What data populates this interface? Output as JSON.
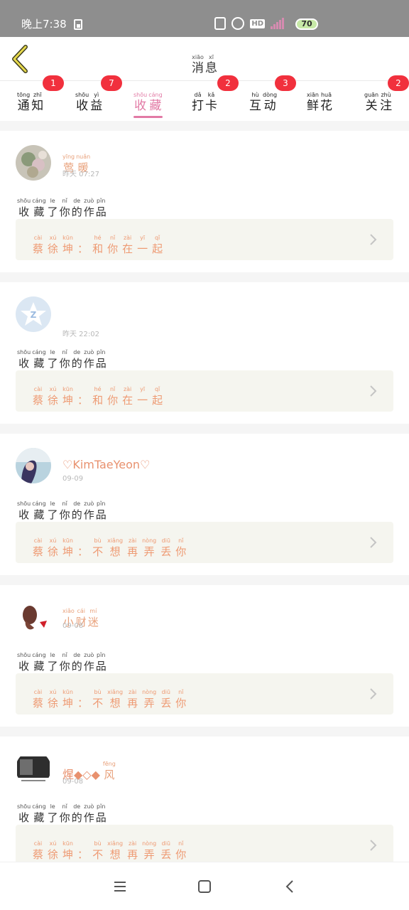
{
  "status_bar": {
    "time": "晚上7:38",
    "hd": "HD",
    "battery": "70"
  },
  "header": {
    "title": [
      {
        "py": "xiāo",
        "hz": "消"
      },
      {
        "py": "xī",
        "hz": "息"
      }
    ]
  },
  "tabs": [
    {
      "label": [
        {
          "py": "tōng",
          "hz": "通"
        },
        {
          "py": "zhī",
          "hz": "知"
        }
      ],
      "badge": "1",
      "active": false
    },
    {
      "label": [
        {
          "py": "shōu",
          "hz": "收"
        },
        {
          "py": "yì",
          "hz": "益"
        }
      ],
      "badge": "7",
      "active": false
    },
    {
      "label": [
        {
          "py": "shōu",
          "hz": "收"
        },
        {
          "py": "cáng",
          "hz": "藏"
        }
      ],
      "badge": "",
      "active": true
    },
    {
      "label": [
        {
          "py": "dǎ",
          "hz": "打"
        },
        {
          "py": "kǎ",
          "hz": "卡"
        }
      ],
      "badge": "2",
      "active": false
    },
    {
      "label": [
        {
          "py": "hù",
          "hz": "互"
        },
        {
          "py": "dòng",
          "hz": "动"
        }
      ],
      "badge": "3",
      "active": false
    },
    {
      "label": [
        {
          "py": "xiān",
          "hz": "鲜"
        },
        {
          "py": "huā",
          "hz": "花"
        }
      ],
      "badge": "",
      "active": false
    },
    {
      "label": [
        {
          "py": "guān",
          "hz": "关"
        },
        {
          "py": "zhù",
          "hz": "注"
        }
      ],
      "badge": "2",
      "active": false
    }
  ],
  "action": [
    {
      "py": "shōu",
      "hz": "收"
    },
    {
      "py": "cáng",
      "hz": "藏"
    },
    {
      "py": "le",
      "hz": "了"
    },
    {
      "py": "nǐ",
      "hz": "你"
    },
    {
      "py": "de",
      "hz": "的"
    },
    {
      "py": "zuò",
      "hz": "作"
    },
    {
      "py": "pǐn",
      "hz": "品"
    }
  ],
  "cards": [
    {
      "username": [
        {
          "py": "yīng",
          "hz": "莺"
        },
        {
          "py": "nuǎn",
          "hz": "暖"
        }
      ],
      "username_plain": "",
      "time": "昨天 07:27",
      "work": [
        {
          "py": "cài",
          "hz": "蔡"
        },
        {
          "py": "xú",
          "hz": "徐"
        },
        {
          "py": "kūn",
          "hz": "坤"
        },
        {
          "py": "",
          "hz": "："
        },
        {
          "py": "hé",
          "hz": "和"
        },
        {
          "py": "nǐ",
          "hz": "你"
        },
        {
          "py": "zài",
          "hz": "在"
        },
        {
          "py": "yī",
          "hz": "一"
        },
        {
          "py": "qǐ",
          "hz": "起"
        }
      ],
      "avatar": "photo-flowers"
    },
    {
      "username": [],
      "username_plain": "",
      "time": "昨天 22:02",
      "work": [
        {
          "py": "cài",
          "hz": "蔡"
        },
        {
          "py": "xú",
          "hz": "徐"
        },
        {
          "py": "kūn",
          "hz": "坤"
        },
        {
          "py": "",
          "hz": "："
        },
        {
          "py": "hé",
          "hz": "和"
        },
        {
          "py": "nǐ",
          "hz": "你"
        },
        {
          "py": "zài",
          "hz": "在"
        },
        {
          "py": "yī",
          "hz": "一"
        },
        {
          "py": "qǐ",
          "hz": "起"
        }
      ],
      "avatar": "qq-star"
    },
    {
      "username": [],
      "username_plain": "♡KimTaeYeon♡",
      "time": "09-09",
      "work": [
        {
          "py": "cài",
          "hz": "蔡"
        },
        {
          "py": "xú",
          "hz": "徐"
        },
        {
          "py": "kūn",
          "hz": "坤"
        },
        {
          "py": "",
          "hz": "："
        },
        {
          "py": "bù",
          "hz": "不"
        },
        {
          "py": "xiǎng",
          "hz": "想"
        },
        {
          "py": "zài",
          "hz": "再"
        },
        {
          "py": "nòng",
          "hz": "弄"
        },
        {
          "py": "diū",
          "hz": "丢"
        },
        {
          "py": "nǐ",
          "hz": "你"
        }
      ],
      "avatar": "photo-girl"
    },
    {
      "username": [
        {
          "py": "xiǎo",
          "hz": "小"
        },
        {
          "py": "cái",
          "hz": "财"
        },
        {
          "py": "mí",
          "hz": "迷"
        }
      ],
      "username_plain": "",
      "time": "09-08",
      "work": [
        {
          "py": "cài",
          "hz": "蔡"
        },
        {
          "py": "xú",
          "hz": "徐"
        },
        {
          "py": "kūn",
          "hz": "坤"
        },
        {
          "py": "",
          "hz": "："
        },
        {
          "py": "bù",
          "hz": "不"
        },
        {
          "py": "xiǎng",
          "hz": "想"
        },
        {
          "py": "zài",
          "hz": "再"
        },
        {
          "py": "nòng",
          "hz": "弄"
        },
        {
          "py": "diū",
          "hz": "丢"
        },
        {
          "py": "nǐ",
          "hz": "你"
        }
      ],
      "avatar": "photo-red"
    },
    {
      "username": [],
      "username_plain": "煋◆◇◆",
      "username_suffix": {
        "py": "fēng",
        "hz": "风"
      },
      "time": "09-08",
      "work": [
        {
          "py": "cài",
          "hz": "蔡"
        },
        {
          "py": "xú",
          "hz": "徐"
        },
        {
          "py": "kūn",
          "hz": "坤"
        },
        {
          "py": "",
          "hz": "："
        },
        {
          "py": "bù",
          "hz": "不"
        },
        {
          "py": "xiǎng",
          "hz": "想"
        },
        {
          "py": "zài",
          "hz": "再"
        },
        {
          "py": "nòng",
          "hz": "弄"
        },
        {
          "py": "diū",
          "hz": "丢"
        },
        {
          "py": "nǐ",
          "hz": "你"
        }
      ],
      "avatar": "photo-dark"
    }
  ],
  "colors": {
    "accent_pink": "#e27aa5",
    "badge_red": "#f1303d",
    "name_orange": "#e8a07a",
    "status_bar_gray": "#8e8e8e",
    "work_box_bg": "#f5f5ef"
  },
  "nav": {
    "icons": [
      "menu-icon",
      "home-icon",
      "back-icon"
    ]
  }
}
